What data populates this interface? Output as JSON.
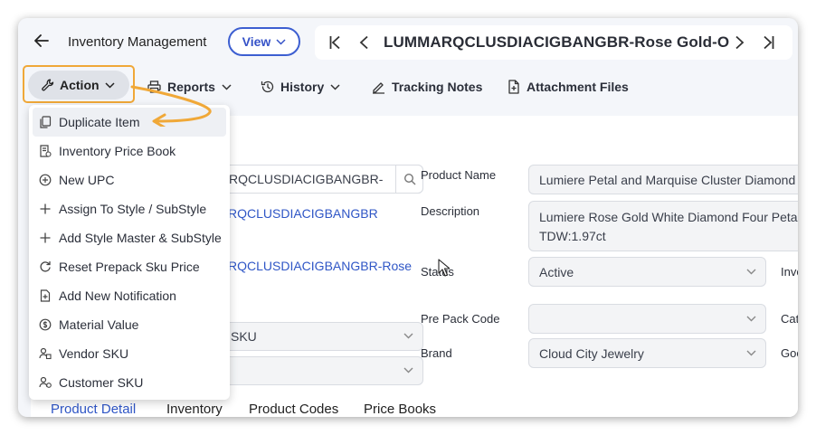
{
  "header": {
    "title": "Inventory Management",
    "view_label": "View",
    "item_title": "LUMMARQCLUSDIACIGBANGBR-Rose Gold-O"
  },
  "toolbar": {
    "action": "Action",
    "reports": "Reports",
    "history": "History",
    "tracking_notes": "Tracking Notes",
    "attachment_files": "Attachment Files"
  },
  "menu": {
    "items": [
      {
        "label": "Duplicate Item",
        "icon": "copy-icon"
      },
      {
        "label": "Inventory Price Book",
        "icon": "price-book-icon"
      },
      {
        "label": "New UPC",
        "icon": "plus-circle-icon"
      },
      {
        "label": "Assign To Style / SubStyle",
        "icon": "plus-icon"
      },
      {
        "label": "Add Style Master & SubStyle",
        "icon": "plus-icon"
      },
      {
        "label": "Reset Prepack Sku Price",
        "icon": "refresh-icon"
      },
      {
        "label": "Add New Notification",
        "icon": "file-plus-icon"
      },
      {
        "label": "Material Value",
        "icon": "dollar-circle-icon"
      },
      {
        "label": "Vendor SKU",
        "icon": "vendor-icon"
      },
      {
        "label": "Customer SKU",
        "icon": "customer-icon"
      }
    ]
  },
  "form": {
    "search_value": "RQCLUSDIACIGBANGBR-",
    "link1": "RQCLUSDIACIGBANGBR",
    "link2": "RQCLUSDIACIGBANGBR-Rose",
    "sku_select": "SKU",
    "product_name_label": "Product Name",
    "product_name_value": "Lumiere Petal and Marquise Cluster Diamond Cl",
    "description_label": "Description",
    "description_line1": "Lumiere Rose Gold White Diamond Four Petal",
    "description_line2": "TDW:1.97ct",
    "status_label": "Status",
    "status_value": "Active",
    "inv_label": "Inve",
    "prepack_label": "Pre Pack Code",
    "prepack_value": "",
    "cat_label": "Cat",
    "brand_label": "Brand",
    "brand_value": "Cloud City Jewelry",
    "goo_label": "Goo"
  },
  "tabs": [
    "Product Detail",
    "Inventory",
    "Product Codes",
    "Price Books"
  ],
  "colors": {
    "accent": "#3552c8",
    "highlight": "#f0a838"
  }
}
